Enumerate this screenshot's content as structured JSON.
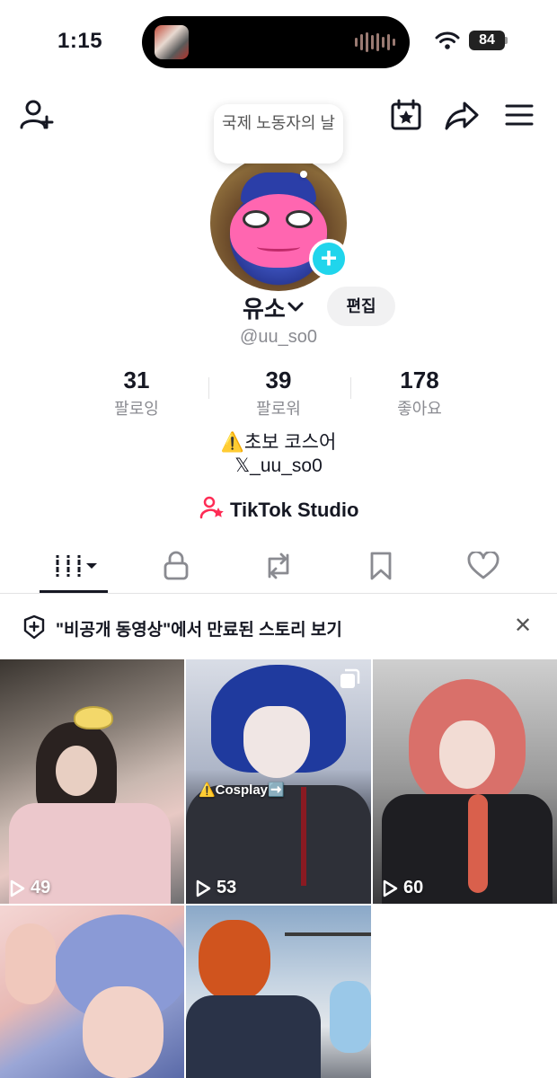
{
  "status_bar": {
    "time": "1:15",
    "battery": "84"
  },
  "profile": {
    "bubble_note": "국제 노동자의 날",
    "display_name": "유소",
    "edit_label": "편집",
    "handle": "@uu_so0"
  },
  "stats": [
    {
      "value": "31",
      "label": "팔로잉"
    },
    {
      "value": "39",
      "label": "팔로워"
    },
    {
      "value": "178",
      "label": "좋아요"
    }
  ],
  "bio": {
    "line1": "⚠️초보 코스어",
    "line2": "𝕏_uu_so0"
  },
  "studio_label": "TikTok Studio",
  "tabs": [
    "videos-tab",
    "private-tab",
    "reposts-tab",
    "saved-tab",
    "liked-tab"
  ],
  "banner": {
    "text": "\"비공개 동영상\"에서 만료된 스토리 보기"
  },
  "videos": [
    {
      "views": "49",
      "tag": ""
    },
    {
      "views": "53",
      "tag": "⚠️Cosplay➡️"
    },
    {
      "views": "60",
      "tag": ""
    },
    {
      "views": "",
      "tag": ""
    },
    {
      "views": "",
      "tag": ""
    }
  ],
  "colors": {
    "accent": "#20d5ec",
    "text": "#161823",
    "muted": "#8a8b91",
    "studio_icon": "#fe2c55"
  }
}
